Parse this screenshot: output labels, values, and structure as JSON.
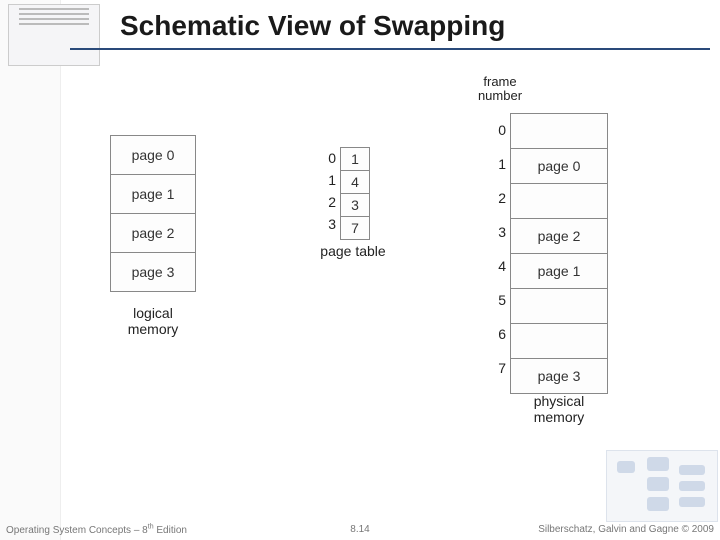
{
  "title": "Schematic View of Swapping",
  "logical_memory": {
    "pages": [
      "page 0",
      "page 1",
      "page 2",
      "page 3"
    ],
    "caption": "logical\nmemory"
  },
  "page_table": {
    "indices": [
      "0",
      "1",
      "2",
      "3"
    ],
    "entries": [
      "1",
      "4",
      "3",
      "7"
    ],
    "caption": "page table"
  },
  "physical_memory": {
    "header_line1": "frame",
    "header_line2": "number",
    "indices": [
      "0",
      "1",
      "2",
      "3",
      "4",
      "5",
      "6",
      "7"
    ],
    "frames": [
      "",
      "page 0",
      "",
      "page 2",
      "page 1",
      "",
      "",
      "page 3"
    ],
    "caption": "physical\nmemory"
  },
  "footer": {
    "left_prefix": "Operating System Concepts – 8",
    "left_sup": "th",
    "left_suffix": " Edition",
    "center": "8.14",
    "right": "Silberschatz, Galvin and Gagne © 2009"
  }
}
